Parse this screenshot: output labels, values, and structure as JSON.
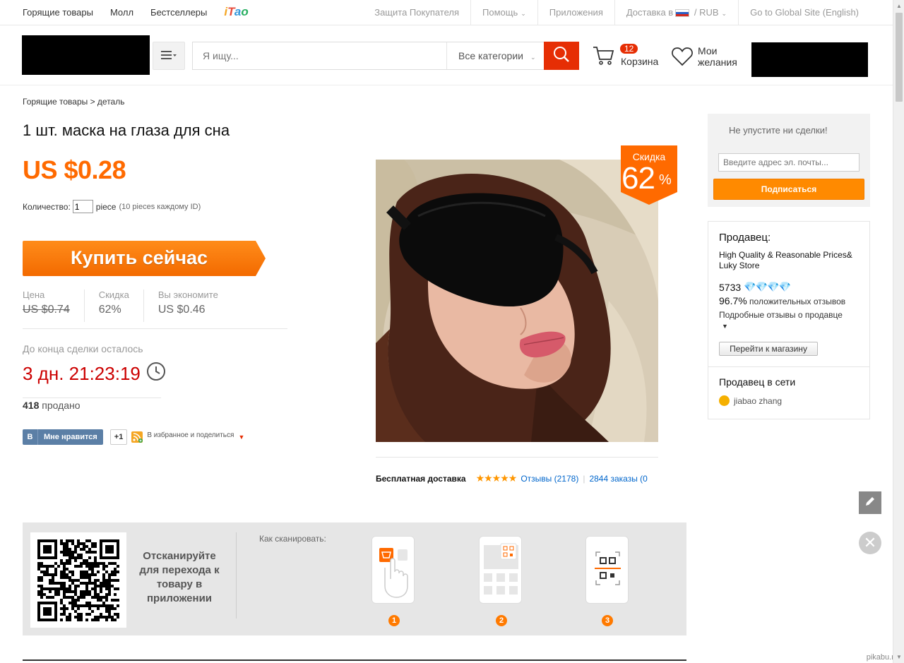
{
  "topbar": {
    "left_links": [
      "Горящие товары",
      "Молл",
      "Бестселлеры"
    ],
    "itao_logo": "iTao",
    "buyer_protection": "Защита Покупателя",
    "help": "Помощь",
    "apps": "Приложения",
    "shipping_to": "Доставка в",
    "separator": "/",
    "currency": "RUB",
    "global_site": "Go to Global Site (English)"
  },
  "header": {
    "search_placeholder": "Я ищу...",
    "all_categories": "Все категории",
    "cart_count": "12",
    "cart_label": "Корзина",
    "wishlist_label_line1": "Мои",
    "wishlist_label_line2": "желания"
  },
  "breadcrumb": "Горящие товары > деталь",
  "product": {
    "title": "1 шт. маска на глаза для сна",
    "price": "US $0.28",
    "quantity_label": "Количество:",
    "quantity_value": "1",
    "unit": "piece",
    "limit_note": "(10 pieces каждому ID)",
    "buy_now": "Купить сейчас",
    "stats": [
      {
        "label": "Цена",
        "value": "US $0.74",
        "strike": true
      },
      {
        "label": "Скидка",
        "value": "62%"
      },
      {
        "label": "Вы экономите",
        "value": "US $0.46"
      }
    ],
    "deal_ends_label": "До конца сделки осталось",
    "countdown": "3 дн. 21:23:19",
    "sold_count": "418",
    "sold_label": "продано",
    "discount_badge_label": "Скидка",
    "discount_badge_value": "62",
    "discount_badge_pct": "%",
    "free_shipping": "Бесплатная доставка",
    "reviews": "Отзывы (2178)",
    "orders": "2844 заказы (0"
  },
  "social": {
    "vk_letter": "В",
    "vk_like": "Мне нравится",
    "plus_one": "+1",
    "favorite_share": "В избранное и поделиться"
  },
  "subscribe": {
    "title": "Не упустите ни сделки!",
    "email_placeholder": "Введите адрес эл. почты...",
    "button": "Подписаться"
  },
  "seller": {
    "heading": "Продавец:",
    "store_name": "High Quality & Reasonable Prices& Luky Store",
    "score": "5733",
    "positive_pct": "96.7%",
    "positive_label": "положительных отзывов",
    "detailed_feedback": "Подробные отзывы о продавце",
    "go_to_store": "Перейти к магазину",
    "online_heading": "Продавец в сети",
    "contact_name": "jiabao zhang"
  },
  "qr": {
    "scan_text": "Отсканируйте для перехода к товару в приложении",
    "how_to_scan": "Как сканировать:",
    "steps": [
      "1",
      "2",
      "3"
    ]
  },
  "watermark": "pikabu.ru",
  "colors": {
    "accent_orange": "#ff6a00",
    "search_red": "#e62e04",
    "countdown_red": "#cc0000",
    "link_blue": "#0066cc"
  }
}
